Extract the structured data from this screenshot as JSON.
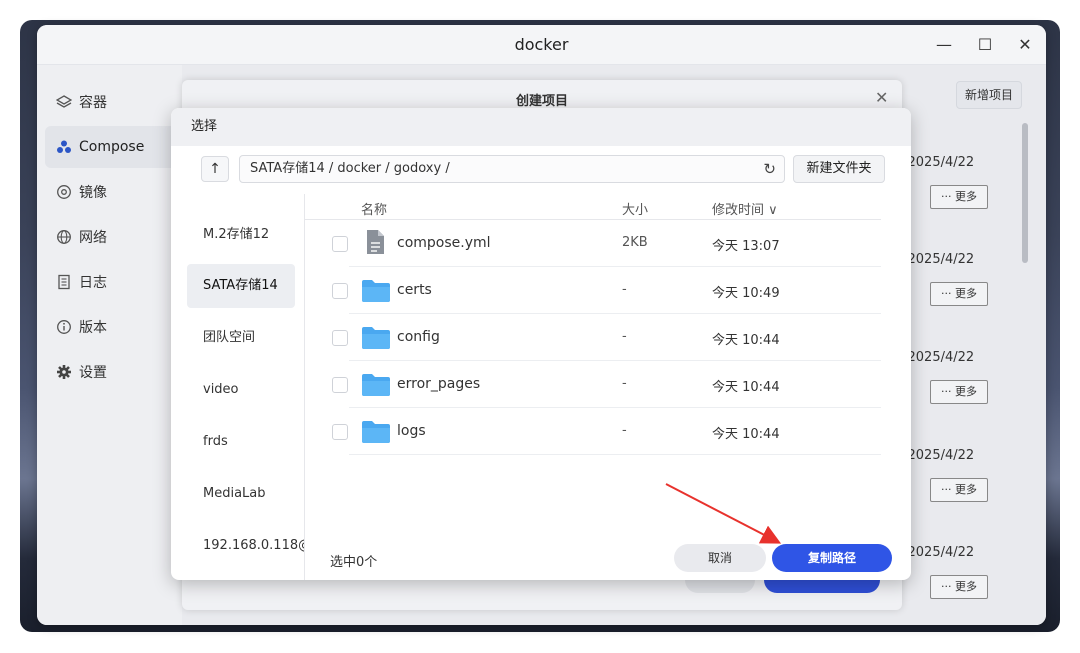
{
  "window": {
    "title": "docker",
    "controls": {
      "minimize": "—",
      "maximize": "☐",
      "close": "✕"
    }
  },
  "sidebar": {
    "items": [
      {
        "label": "容器",
        "icon": "layers-icon",
        "active": false
      },
      {
        "label": "Compose",
        "icon": "compose-icon",
        "active": true
      },
      {
        "label": "镜像",
        "icon": "disc-icon",
        "active": false
      },
      {
        "label": "网络",
        "icon": "globe-icon",
        "active": false
      },
      {
        "label": "日志",
        "icon": "log-icon",
        "active": false
      },
      {
        "label": "版本",
        "icon": "info-icon",
        "active": false
      },
      {
        "label": "设置",
        "icon": "gear-icon",
        "active": false
      }
    ]
  },
  "main": {
    "new_project_label": "新增项目",
    "rows": [
      {
        "date": ": 2025/4/22",
        "more_label": "··· 更多"
      },
      {
        "date": ": 2025/4/22",
        "more_label": "··· 更多"
      },
      {
        "date": ": 2025/4/22",
        "more_label": "··· 更多"
      },
      {
        "date": ": 2025/4/22",
        "more_label": "··· 更多"
      },
      {
        "date": ": 2025/4/22",
        "more_label": "··· 更多"
      }
    ]
  },
  "create_dialog": {
    "title": "创建项目",
    "close": "✕"
  },
  "picker": {
    "title": "选择",
    "up_label": "↑",
    "path": "SATA存储14 / docker / godoxy /",
    "refresh_label": "↻",
    "new_folder_label": "新建文件夹",
    "locations": [
      {
        "label": "M.2存储12",
        "active": false
      },
      {
        "label": "SATA存储14",
        "active": true
      },
      {
        "label": "团队空间",
        "active": false
      },
      {
        "label": "video",
        "active": false
      },
      {
        "label": "frds",
        "active": false
      },
      {
        "label": "MediaLab",
        "active": false
      },
      {
        "label": "192.168.0.118@",
        "active": false
      }
    ],
    "columns": {
      "name": "名称",
      "size": "大小",
      "mtime": "修改时间 ∨"
    },
    "files": [
      {
        "name": "compose.yml",
        "size": "2KB",
        "mtime": "今天 13:07",
        "type": "file"
      },
      {
        "name": "certs",
        "size": "-",
        "mtime": "今天 10:49",
        "type": "folder"
      },
      {
        "name": "config",
        "size": "-",
        "mtime": "今天 10:44",
        "type": "folder"
      },
      {
        "name": "error_pages",
        "size": "-",
        "mtime": "今天 10:44",
        "type": "folder"
      },
      {
        "name": "logs",
        "size": "-",
        "mtime": "今天 10:44",
        "type": "folder"
      }
    ],
    "selected_count": "选中0个",
    "cancel_label": "取消",
    "copy_path_label": "复制路径"
  },
  "colors": {
    "accent": "#2f55e6",
    "folder": "#4aa8f0",
    "arrow": "#e8322d"
  }
}
